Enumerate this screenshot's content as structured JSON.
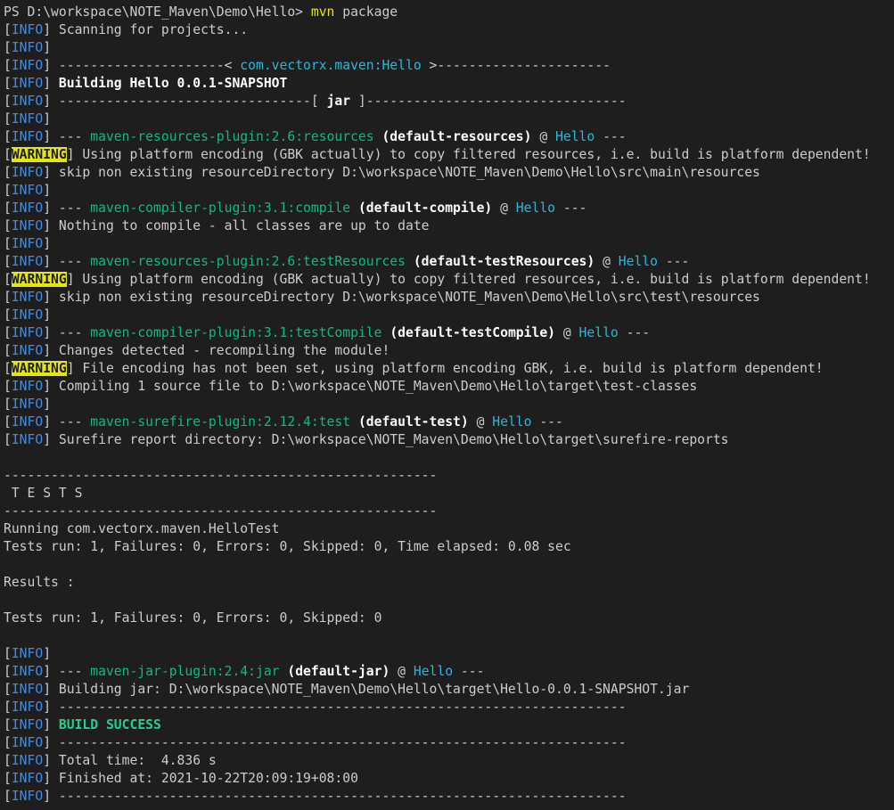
{
  "terminal": {
    "lines": [
      [
        {
          "t": "PS D:\\workspace\\NOTE_Maven\\Demo\\Hello> ",
          "c": "plain"
        },
        {
          "t": "mvn",
          "c": "cmd"
        },
        {
          "t": " package",
          "c": "plain"
        }
      ],
      [
        {
          "t": "[",
          "c": "plain"
        },
        {
          "t": "INFO",
          "c": "info"
        },
        {
          "t": "] Scanning for projects...",
          "c": "plain"
        }
      ],
      [
        {
          "t": "[",
          "c": "plain"
        },
        {
          "t": "INFO",
          "c": "info"
        },
        {
          "t": "]",
          "c": "plain"
        }
      ],
      [
        {
          "t": "[",
          "c": "plain"
        },
        {
          "t": "INFO",
          "c": "info"
        },
        {
          "t": "] ---------------------< ",
          "c": "plain"
        },
        {
          "t": "com.vectorx.maven:Hello",
          "c": "cyan"
        },
        {
          "t": " >----------------------",
          "c": "plain"
        }
      ],
      [
        {
          "t": "[",
          "c": "plain"
        },
        {
          "t": "INFO",
          "c": "info"
        },
        {
          "t": "] ",
          "c": "plain"
        },
        {
          "t": "Building Hello 0.0.1-SNAPSHOT",
          "c": "bold"
        }
      ],
      [
        {
          "t": "[",
          "c": "plain"
        },
        {
          "t": "INFO",
          "c": "info"
        },
        {
          "t": "] --------------------------------[ ",
          "c": "plain"
        },
        {
          "t": "jar",
          "c": "bold"
        },
        {
          "t": " ]---------------------------------",
          "c": "plain"
        }
      ],
      [
        {
          "t": "[",
          "c": "plain"
        },
        {
          "t": "INFO",
          "c": "info"
        },
        {
          "t": "]",
          "c": "plain"
        }
      ],
      [
        {
          "t": "[",
          "c": "plain"
        },
        {
          "t": "INFO",
          "c": "info"
        },
        {
          "t": "] --- ",
          "c": "plain"
        },
        {
          "t": "maven-resources-plugin:2.6:resources",
          "c": "plugin"
        },
        {
          "t": " ",
          "c": "plain"
        },
        {
          "t": "(default-resources)",
          "c": "bold"
        },
        {
          "t": " @ ",
          "c": "plain"
        },
        {
          "t": "Hello",
          "c": "cyan"
        },
        {
          "t": " ---",
          "c": "plain"
        }
      ],
      [
        {
          "t": "[",
          "c": "plain"
        },
        {
          "t": "WARNING",
          "c": "warning"
        },
        {
          "t": "] Using platform encoding (GBK actually) to copy filtered resources, i.e. build is platform dependent!",
          "c": "plain"
        }
      ],
      [
        {
          "t": "[",
          "c": "plain"
        },
        {
          "t": "INFO",
          "c": "info"
        },
        {
          "t": "] skip non existing resourceDirectory D:\\workspace\\NOTE_Maven\\Demo\\Hello\\src\\main\\resources",
          "c": "plain"
        }
      ],
      [
        {
          "t": "[",
          "c": "plain"
        },
        {
          "t": "INFO",
          "c": "info"
        },
        {
          "t": "]",
          "c": "plain"
        }
      ],
      [
        {
          "t": "[",
          "c": "plain"
        },
        {
          "t": "INFO",
          "c": "info"
        },
        {
          "t": "] --- ",
          "c": "plain"
        },
        {
          "t": "maven-compiler-plugin:3.1:compile",
          "c": "plugin"
        },
        {
          "t": " ",
          "c": "plain"
        },
        {
          "t": "(default-compile)",
          "c": "bold"
        },
        {
          "t": " @ ",
          "c": "plain"
        },
        {
          "t": "Hello",
          "c": "cyan"
        },
        {
          "t": " ---",
          "c": "plain"
        }
      ],
      [
        {
          "t": "[",
          "c": "plain"
        },
        {
          "t": "INFO",
          "c": "info"
        },
        {
          "t": "] Nothing to compile - all classes are up to date",
          "c": "plain"
        }
      ],
      [
        {
          "t": "[",
          "c": "plain"
        },
        {
          "t": "INFO",
          "c": "info"
        },
        {
          "t": "]",
          "c": "plain"
        }
      ],
      [
        {
          "t": "[",
          "c": "plain"
        },
        {
          "t": "INFO",
          "c": "info"
        },
        {
          "t": "] --- ",
          "c": "plain"
        },
        {
          "t": "maven-resources-plugin:2.6:testResources",
          "c": "plugin"
        },
        {
          "t": " ",
          "c": "plain"
        },
        {
          "t": "(default-testResources)",
          "c": "bold"
        },
        {
          "t": " @ ",
          "c": "plain"
        },
        {
          "t": "Hello",
          "c": "cyan"
        },
        {
          "t": " ---",
          "c": "plain"
        }
      ],
      [
        {
          "t": "[",
          "c": "plain"
        },
        {
          "t": "WARNING",
          "c": "warning"
        },
        {
          "t": "] Using platform encoding (GBK actually) to copy filtered resources, i.e. build is platform dependent!",
          "c": "plain"
        }
      ],
      [
        {
          "t": "[",
          "c": "plain"
        },
        {
          "t": "INFO",
          "c": "info"
        },
        {
          "t": "] skip non existing resourceDirectory D:\\workspace\\NOTE_Maven\\Demo\\Hello\\src\\test\\resources",
          "c": "plain"
        }
      ],
      [
        {
          "t": "[",
          "c": "plain"
        },
        {
          "t": "INFO",
          "c": "info"
        },
        {
          "t": "]",
          "c": "plain"
        }
      ],
      [
        {
          "t": "[",
          "c": "plain"
        },
        {
          "t": "INFO",
          "c": "info"
        },
        {
          "t": "] --- ",
          "c": "plain"
        },
        {
          "t": "maven-compiler-plugin:3.1:testCompile",
          "c": "plugin"
        },
        {
          "t": " ",
          "c": "plain"
        },
        {
          "t": "(default-testCompile)",
          "c": "bold"
        },
        {
          "t": " @ ",
          "c": "plain"
        },
        {
          "t": "Hello",
          "c": "cyan"
        },
        {
          "t": " ---",
          "c": "plain"
        }
      ],
      [
        {
          "t": "[",
          "c": "plain"
        },
        {
          "t": "INFO",
          "c": "info"
        },
        {
          "t": "] Changes detected - recompiling the module!",
          "c": "plain"
        }
      ],
      [
        {
          "t": "[",
          "c": "plain"
        },
        {
          "t": "WARNING",
          "c": "warning"
        },
        {
          "t": "] File encoding has not been set, using platform encoding GBK, i.e. build is platform dependent!",
          "c": "plain"
        }
      ],
      [
        {
          "t": "[",
          "c": "plain"
        },
        {
          "t": "INFO",
          "c": "info"
        },
        {
          "t": "] Compiling 1 source file to D:\\workspace\\NOTE_Maven\\Demo\\Hello\\target\\test-classes",
          "c": "plain"
        }
      ],
      [
        {
          "t": "[",
          "c": "plain"
        },
        {
          "t": "INFO",
          "c": "info"
        },
        {
          "t": "]",
          "c": "plain"
        }
      ],
      [
        {
          "t": "[",
          "c": "plain"
        },
        {
          "t": "INFO",
          "c": "info"
        },
        {
          "t": "] --- ",
          "c": "plain"
        },
        {
          "t": "maven-surefire-plugin:2.12.4:test",
          "c": "plugin"
        },
        {
          "t": " ",
          "c": "plain"
        },
        {
          "t": "(default-test)",
          "c": "bold"
        },
        {
          "t": " @ ",
          "c": "plain"
        },
        {
          "t": "Hello",
          "c": "cyan"
        },
        {
          "t": " ---",
          "c": "plain"
        }
      ],
      [
        {
          "t": "[",
          "c": "plain"
        },
        {
          "t": "INFO",
          "c": "info"
        },
        {
          "t": "] Surefire report directory: D:\\workspace\\NOTE_Maven\\Demo\\Hello\\target\\surefire-reports",
          "c": "plain"
        }
      ],
      [],
      [
        {
          "t": "-------------------------------------------------------",
          "c": "plain"
        }
      ],
      [
        {
          "t": " T E S T S",
          "c": "plain"
        }
      ],
      [
        {
          "t": "-------------------------------------------------------",
          "c": "plain"
        }
      ],
      [
        {
          "t": "Running com.vectorx.maven.HelloTest",
          "c": "plain"
        }
      ],
      [
        {
          "t": "Tests run: 1, Failures: 0, Errors: 0, Skipped: 0, Time elapsed: 0.08 sec",
          "c": "plain"
        }
      ],
      [],
      [
        {
          "t": "Results :",
          "c": "plain"
        }
      ],
      [],
      [
        {
          "t": "Tests run: 1, Failures: 0, Errors: 0, Skipped: 0",
          "c": "plain"
        }
      ],
      [],
      [
        {
          "t": "[",
          "c": "plain"
        },
        {
          "t": "INFO",
          "c": "info"
        },
        {
          "t": "]",
          "c": "plain"
        }
      ],
      [
        {
          "t": "[",
          "c": "plain"
        },
        {
          "t": "INFO",
          "c": "info"
        },
        {
          "t": "] --- ",
          "c": "plain"
        },
        {
          "t": "maven-jar-plugin:2.4:jar",
          "c": "plugin"
        },
        {
          "t": " ",
          "c": "plain"
        },
        {
          "t": "(default-jar)",
          "c": "bold"
        },
        {
          "t": " @ ",
          "c": "plain"
        },
        {
          "t": "Hello",
          "c": "cyan"
        },
        {
          "t": " ---",
          "c": "plain"
        }
      ],
      [
        {
          "t": "[",
          "c": "plain"
        },
        {
          "t": "INFO",
          "c": "info"
        },
        {
          "t": "] Building jar: D:\\workspace\\NOTE_Maven\\Demo\\Hello\\target\\Hello-0.0.1-SNAPSHOT.jar",
          "c": "plain"
        }
      ],
      [
        {
          "t": "[",
          "c": "plain"
        },
        {
          "t": "INFO",
          "c": "info"
        },
        {
          "t": "] ------------------------------------------------------------------------",
          "c": "plain"
        }
      ],
      [
        {
          "t": "[",
          "c": "plain"
        },
        {
          "t": "INFO",
          "c": "info"
        },
        {
          "t": "] ",
          "c": "plain"
        },
        {
          "t": "BUILD SUCCESS",
          "c": "green"
        }
      ],
      [
        {
          "t": "[",
          "c": "plain"
        },
        {
          "t": "INFO",
          "c": "info"
        },
        {
          "t": "] ------------------------------------------------------------------------",
          "c": "plain"
        }
      ],
      [
        {
          "t": "[",
          "c": "plain"
        },
        {
          "t": "INFO",
          "c": "info"
        },
        {
          "t": "] Total time:  4.836 s",
          "c": "plain"
        }
      ],
      [
        {
          "t": "[",
          "c": "plain"
        },
        {
          "t": "INFO",
          "c": "info"
        },
        {
          "t": "] Finished at: 2021-10-22T20:09:19+08:00",
          "c": "plain"
        }
      ],
      [
        {
          "t": "[",
          "c": "plain"
        },
        {
          "t": "INFO",
          "c": "info"
        },
        {
          "t": "] ------------------------------------------------------------------------",
          "c": "plain"
        }
      ]
    ]
  },
  "colors": {
    "background": "#1e1e1e",
    "foreground": "#cccccc",
    "info": "#3b8eea",
    "warning_bg": "#e5e510",
    "cyan": "#29b8db",
    "plugin_green": "#0dbc79",
    "success_green": "#23d18b"
  }
}
